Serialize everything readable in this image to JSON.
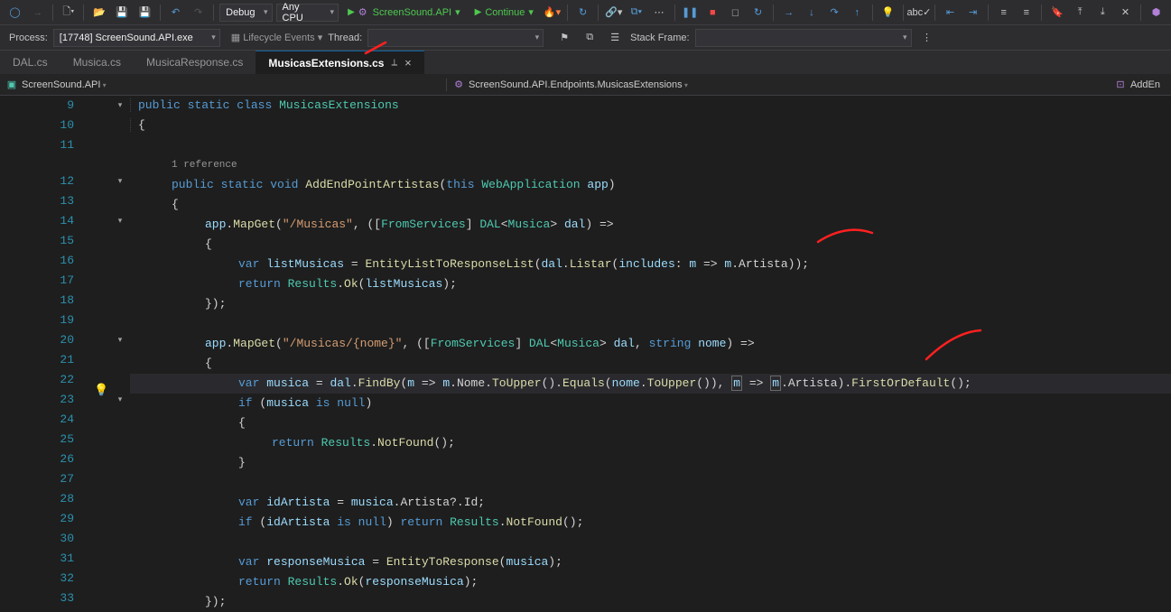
{
  "toolbar": {
    "config": "Debug",
    "platform": "Any CPU",
    "startup_project": "ScreenSound.API",
    "continue": "Continue"
  },
  "debug_bar": {
    "process_label": "Process:",
    "process_value": "[17748] ScreenSound.API.exe",
    "lifecycle": "Lifecycle Events",
    "thread_label": "Thread:",
    "stackframe_label": "Stack Frame:"
  },
  "tabs": [
    {
      "label": "DAL.cs",
      "active": false
    },
    {
      "label": "Musica.cs",
      "active": false
    },
    {
      "label": "MusicaResponse.cs",
      "active": false
    },
    {
      "label": "MusicasExtensions.cs",
      "active": true
    }
  ],
  "context": {
    "project": "ScreenSound.API",
    "symbol": "ScreenSound.API.Endpoints.MusicasExtensions",
    "action": "AddEn"
  },
  "code": {
    "lines": [
      9,
      10,
      11,
      12,
      13,
      14,
      15,
      16,
      17,
      18,
      19,
      20,
      21,
      22,
      23,
      24,
      25,
      26,
      27,
      28,
      29,
      30,
      31,
      32,
      33
    ],
    "ref_lens": "1 reference",
    "l9": {
      "kw1": "public",
      "kw2": "static",
      "kw3": "class",
      "type": "MusicasExtensions"
    },
    "l12": {
      "kw1": "public",
      "kw2": "static",
      "kw3": "void",
      "method": "AddEndPointArtistas",
      "kw4": "this",
      "type": "WebApplication",
      "param": "app"
    },
    "l14": {
      "obj": "app",
      "method": "MapGet",
      "str": "\"/Musicas\"",
      "attr": "FromServices",
      "type": "DAL",
      "gen": "Musica",
      "param": "dal"
    },
    "l16": {
      "kw": "var",
      "var": "listMusicas",
      "method": "EntityListToResponseList",
      "obj": "dal",
      "m2": "Listar",
      "named": "includes",
      "p": "m",
      "p2": "m",
      "prop": "Artista"
    },
    "l17": {
      "kw": "return",
      "type": "Results",
      "method": "Ok",
      "var": "listMusicas"
    },
    "l20": {
      "obj": "app",
      "method": "MapGet",
      "str": "\"/Musicas/{nome}\"",
      "attr": "FromServices",
      "type": "DAL",
      "gen": "Musica",
      "p1": "dal",
      "kw": "string",
      "p2": "nome"
    },
    "l22": {
      "kw": "var",
      "var": "musica",
      "obj": "dal",
      "m": "FindBy",
      "p": "m",
      "p2": "m",
      "prop": "Nome",
      "m2": "ToUpper",
      "m3": "Equals",
      "v": "nome",
      "m4": "ToUpper",
      "p3": "m",
      "p4": "m",
      "prop2": "Artista",
      "m5": "FirstOrDefault"
    },
    "l23": {
      "kw": "if",
      "var": "musica",
      "kw2": "is",
      "kw3": "null"
    },
    "l25": {
      "kw": "return",
      "type": "Results",
      "method": "NotFound"
    },
    "l28": {
      "kw": "var",
      "var": "idArtista",
      "v2": "musica",
      "prop": "Artista",
      "prop2": "Id"
    },
    "l29": {
      "kw": "if",
      "var": "idArtista",
      "kw2": "is",
      "kw3": "null",
      "kw4": "return",
      "type": "Results",
      "method": "NotFound"
    },
    "l31": {
      "kw": "var",
      "var": "responseMusica",
      "method": "EntityToResponse",
      "arg": "musica"
    },
    "l32": {
      "kw": "return",
      "type": "Results",
      "method": "Ok",
      "var": "responseMusica"
    }
  }
}
